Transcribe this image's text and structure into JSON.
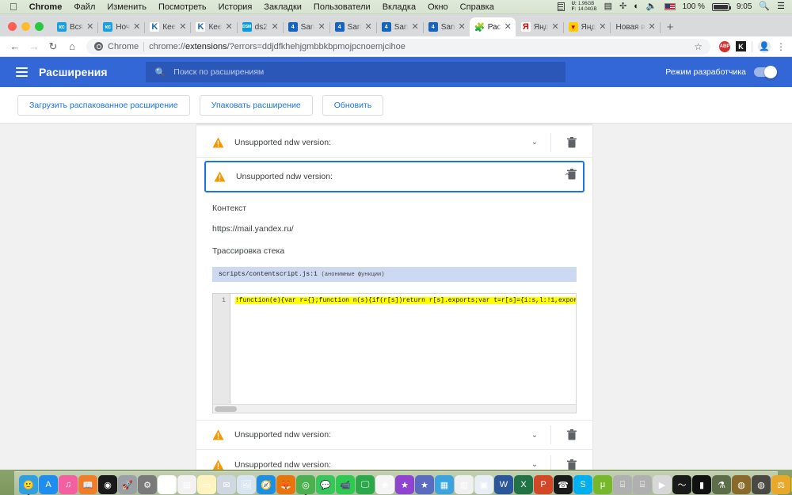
{
  "menubar": {
    "apple_icon": "apple-icon",
    "items": [
      "Chrome",
      "Файл",
      "Изменить",
      "Посмотреть",
      "История",
      "Закладки",
      "Пользователи",
      "Вкладка",
      "Окно",
      "Справка"
    ],
    "status": {
      "mem_label_1": "M",
      "mem_label_2": "M",
      "mem_used_label": "U:",
      "mem_used": "1.96GB",
      "mem_free_label": "F:",
      "mem_free": "14.04GB",
      "battery_percent": "100 %",
      "clock": "9:05",
      "search_icon": "search-icon",
      "list_icon": "control-center-icon",
      "wifi_icon": "wifi-icon",
      "volume_icon": "volume-icon",
      "flag_icon": "us-flag-icon",
      "bluetooth_icon": "bluetooth-icon",
      "battery_icon": "battery-icon"
    }
  },
  "tabs": [
    {
      "label": "Вся",
      "favicon": "kc",
      "favicon_bg": "#1a9fe0",
      "active": false
    },
    {
      "label": "Ноч",
      "favicon": "kc",
      "favicon_bg": "#1a9fe0",
      "active": false
    },
    {
      "label": "Кее",
      "favicon": "K",
      "favicon_bg": "#ffffff",
      "favicon_fg": "#1565c0",
      "active": false
    },
    {
      "label": "Кее",
      "favicon": "K",
      "favicon_bg": "#ffffff",
      "favicon_fg": "#1565c0",
      "active": false
    },
    {
      "label": "ds2",
      "favicon": "DSM",
      "favicon_bg": "#0b9ae0",
      "active": false
    },
    {
      "label": "San",
      "favicon": "4",
      "favicon_bg": "#1565c0",
      "active": false
    },
    {
      "label": "San",
      "favicon": "4",
      "favicon_bg": "#1565c0",
      "active": false
    },
    {
      "label": "San",
      "favicon": "4",
      "favicon_bg": "#1565c0",
      "active": false
    },
    {
      "label": "San",
      "favicon": "4",
      "favicon_bg": "#1565c0",
      "active": false
    },
    {
      "label": "Рас",
      "favicon": "puzzle",
      "favicon_bg": "transparent",
      "favicon_fg": "#1a73e8",
      "active": true
    },
    {
      "label": "Янд",
      "favicon": "Я",
      "favicon_bg": "#ffffff",
      "favicon_fg": "#e00000",
      "active": false
    },
    {
      "label": "Янд",
      "favicon": "mail",
      "favicon_bg": "#ffcc00",
      "active": false
    },
    {
      "label": "Новая в",
      "favicon": "none",
      "favicon_bg": "transparent",
      "active": false
    }
  ],
  "tab_close_label": "✕",
  "newtab_label": "+",
  "omnibox": {
    "back_icon": "back-arrow-icon",
    "forward_icon": "forward-arrow-icon",
    "reload_icon": "reload-icon",
    "home_icon": "home-icon",
    "site_icon": "chrome-settings-icon",
    "scheme_label": "Chrome",
    "url_prefix": "chrome://",
    "url_bold": "extensions",
    "url_suffix": "/?errors=ddjdfkhehjgmbbkbpmojpcnoemjcihoe",
    "star_icon": "bookmark-star-icon",
    "ext1_label": "ABP",
    "ext2_label": "K",
    "avatar_icon": "profile-avatar-icon",
    "menu_icon": "three-dots-menu-icon"
  },
  "extensions_header": {
    "menu_icon": "hamburger-menu-icon",
    "title": "Расширения",
    "search_icon": "search-icon",
    "search_placeholder": "Поиск по расширениям",
    "search_value": "",
    "dev_mode_label": "Режим разработчика",
    "dev_mode_on": true,
    "accent_color": "#3367d6"
  },
  "action_bar": {
    "load_unpacked": "Загрузить распакованное расширение",
    "pack_extension": "Упаковать расширение",
    "update": "Обновить",
    "link_color": "#1a73e8"
  },
  "errors": {
    "warning_color": "#f29900",
    "selected_border_color": "#1a73e8",
    "chevron_down": "⌄",
    "chevron_up": "⌃",
    "trash_icon": "delete-icon",
    "rows": [
      {
        "title": "Unsupported ndw version:",
        "expanded": false,
        "selected": false,
        "partial_top": true
      },
      {
        "title": "Unsupported ndw version:",
        "expanded": true,
        "selected": true,
        "partial_top": false
      },
      {
        "title": "Unsupported ndw version:",
        "expanded": false,
        "selected": false,
        "partial_top": false
      },
      {
        "title": "Unsupported ndw version:",
        "expanded": false,
        "selected": false,
        "partial_top": false
      }
    ]
  },
  "detail": {
    "context_label": "Контекст",
    "context_value": "https://mail.yandex.ru/",
    "stack_label": "Трассировка стека",
    "stack_frame": "scripts/contentscript.js:1",
    "stack_frame_note": "(анонимные функции)",
    "code_line_number": "1",
    "code_line": "!function(e){var r={};function n(s){if(r[s])return r[s].exports;var t=r[s]={i:s,l:!1,expor",
    "highlight_color": "#ffff00"
  },
  "dock": {
    "icons": [
      {
        "name": "finder",
        "glyph": "🙂",
        "bg": "#2e9fe0",
        "running": true
      },
      {
        "name": "app-store",
        "glyph": "A",
        "bg": "#1f8cf0",
        "running": false
      },
      {
        "name": "itunes",
        "glyph": "♫",
        "bg": "#f45fa0",
        "running": false
      },
      {
        "name": "ibooks",
        "glyph": "📖",
        "bg": "#f07d28",
        "running": false
      },
      {
        "name": "safari-compass",
        "glyph": "◉",
        "bg": "#1a1a1a",
        "running": false
      },
      {
        "name": "launchpad",
        "glyph": "🚀",
        "bg": "#9aa0a6",
        "running": false
      },
      {
        "name": "system-preferences",
        "glyph": "⚙",
        "bg": "#7a7a7a",
        "running": false
      },
      {
        "name": "calendar",
        "glyph": "23",
        "bg": "#ffffff",
        "running": false
      },
      {
        "name": "contacts",
        "glyph": "▤",
        "bg": "#f2f2f2",
        "running": false
      },
      {
        "name": "notes",
        "glyph": "▭",
        "bg": "#fff3c0",
        "running": false
      },
      {
        "name": "mail-folder",
        "glyph": "✉",
        "bg": "#cfd8e0",
        "running": false
      },
      {
        "name": "preview",
        "glyph": "🖼",
        "bg": "#d8e4ef",
        "running": false
      },
      {
        "name": "safari",
        "glyph": "🧭",
        "bg": "#1e8fe0",
        "running": false
      },
      {
        "name": "firefox",
        "glyph": "🦊",
        "bg": "#e8740c",
        "running": false
      },
      {
        "name": "chrome",
        "glyph": "◎",
        "bg": "#4caf50",
        "running": true
      },
      {
        "name": "messages",
        "glyph": "💬",
        "bg": "#35c759",
        "running": false
      },
      {
        "name": "facetime",
        "glyph": "📹",
        "bg": "#2ec94f",
        "running": false
      },
      {
        "name": "screen-sharing",
        "glyph": "🖵",
        "bg": "#2aa84a",
        "running": false
      },
      {
        "name": "photos",
        "glyph": "❀",
        "bg": "#f5f5f5",
        "running": false
      },
      {
        "name": "star-app",
        "glyph": "★",
        "bg": "#8e44d0",
        "running": false
      },
      {
        "name": "imovie",
        "glyph": "★",
        "bg": "#5b6bbf",
        "running": false
      },
      {
        "name": "keynote-doc",
        "glyph": "▦",
        "bg": "#3aa3e0",
        "running": false
      },
      {
        "name": "numbers",
        "glyph": "▥",
        "bg": "#f0f0f0",
        "running": false
      },
      {
        "name": "keynote",
        "glyph": "▣",
        "bg": "#e8eef4",
        "running": false
      },
      {
        "name": "word",
        "glyph": "W",
        "bg": "#2b579a",
        "running": false
      },
      {
        "name": "excel",
        "glyph": "X",
        "bg": "#217346",
        "running": false
      },
      {
        "name": "powerpoint",
        "glyph": "P",
        "bg": "#d24726",
        "running": false
      },
      {
        "name": "phone",
        "glyph": "☎",
        "bg": "#1a1a1a",
        "running": false
      },
      {
        "name": "skype",
        "glyph": "S",
        "bg": "#00aff0",
        "running": false
      },
      {
        "name": "utorrent",
        "glyph": "μ",
        "bg": "#76b82a",
        "running": false
      },
      {
        "name": "usb-drive-1",
        "glyph": "⌸",
        "bg": "#b0b0b0",
        "running": false
      },
      {
        "name": "usb-drive-2",
        "glyph": "⌸",
        "bg": "#b0b0b0",
        "running": false
      },
      {
        "name": "vlc-player",
        "glyph": "▶",
        "bg": "#d8d8d8",
        "running": false
      },
      {
        "name": "audio-editor",
        "glyph": "〜",
        "bg": "#1a1a1a",
        "running": false
      },
      {
        "name": "terminal",
        "glyph": "▮",
        "bg": "#111111",
        "running": false
      },
      {
        "name": "microscope-app",
        "glyph": "⚗",
        "bg": "#5d6d4a",
        "running": false
      },
      {
        "name": "coin-app-1",
        "glyph": "◍",
        "bg": "#8a6a2a",
        "running": false
      },
      {
        "name": "coin-app-2",
        "glyph": "◍",
        "bg": "#4a4a42",
        "running": false
      },
      {
        "name": "bee-app",
        "glyph": "⚖",
        "bg": "#e8a92a",
        "running": false
      },
      {
        "name": "wasp-app",
        "glyph": "🐝",
        "bg": "#f0c000",
        "running": false
      },
      {
        "name": "teamviewer",
        "glyph": "↻",
        "bg": "#0e8ee9",
        "running": false
      },
      {
        "name": "disk-app",
        "glyph": "◕",
        "bg": "#2b2b38",
        "running": false
      },
      {
        "name": "plant-app",
        "glyph": "🌿",
        "bg": "#74a83a",
        "running": false
      },
      {
        "name": "paint-app",
        "glyph": "◐",
        "bg": "#f5f5f5",
        "running": false
      },
      {
        "name": "arrow-app",
        "glyph": "❯",
        "bg": "#1a1a1a",
        "running": false
      },
      {
        "name": "printer",
        "glyph": "🖨",
        "bg": "#c9ccd0",
        "running": false
      },
      {
        "name": "document",
        "glyph": "📄",
        "bg": "#f4f4f4",
        "running": false
      },
      {
        "name": "folder-1",
        "glyph": "▤",
        "bg": "#6cc6f0",
        "running": false
      },
      {
        "name": "folder-2",
        "glyph": "▤",
        "bg": "#6cc6f0",
        "running": false
      },
      {
        "name": "trash",
        "glyph": "🗑",
        "bg": "#eaeaea",
        "running": false
      }
    ]
  }
}
